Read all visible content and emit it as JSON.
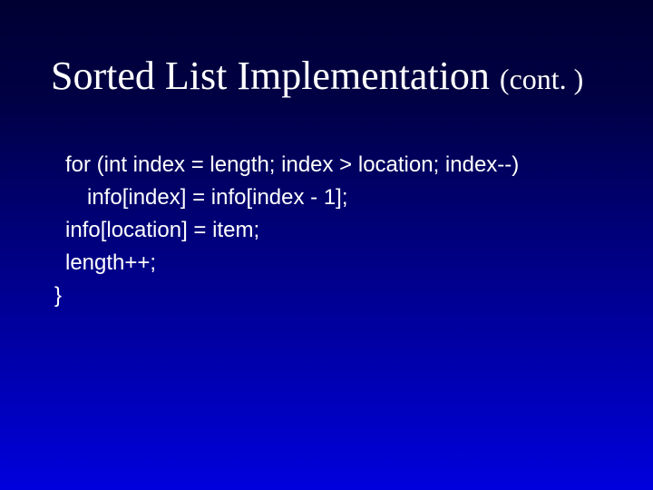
{
  "slide": {
    "title_main": "Sorted List Implementation ",
    "title_cont": "(cont. )",
    "code": {
      "line1": "for (int index = length; index > location; index--)",
      "line2": "info[index] = info[index - 1];",
      "line3": "info[location] = item;",
      "line4": "length++;",
      "line5": "}"
    }
  }
}
